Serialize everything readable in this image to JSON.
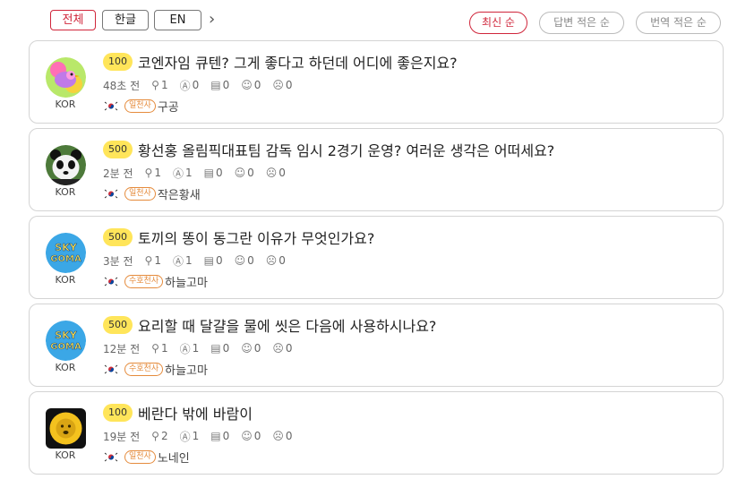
{
  "lang_tabs": [
    {
      "label": "전체",
      "active": true
    },
    {
      "label": "한글",
      "active": false
    },
    {
      "label": "EN",
      "active": false
    }
  ],
  "next_icon": "chevron-right-icon",
  "sort_options": [
    {
      "label": "최신 순",
      "active": true
    },
    {
      "label": "답변 적은 순",
      "active": false
    },
    {
      "label": "번역 적은 순",
      "active": false
    }
  ],
  "questions": [
    {
      "points": "100",
      "title": "코엔자임 큐텐? 그게 좋다고 하던데 어디에 좋은지요?",
      "time": "48초 전",
      "views": "1",
      "answers": "0",
      "comments": "0",
      "likes": "0",
      "dislikes": "0",
      "country": "KOR",
      "rank": "일천사",
      "user": "구공",
      "avatar": "bird-avatar"
    },
    {
      "points": "500",
      "title": "황선홍 올림픽대표팀 감독 임시 2경기 운영? 여러운 생각은 어떠세요?",
      "time": "2분 전",
      "views": "1",
      "answers": "1",
      "comments": "0",
      "likes": "0",
      "dislikes": "0",
      "country": "KOR",
      "rank": "일천사",
      "user": "작은황새",
      "avatar": "panda-avatar"
    },
    {
      "points": "500",
      "title": "토끼의 똥이 동그란 이유가 무엇인가요?",
      "time": "3분 전",
      "views": "1",
      "answers": "1",
      "comments": "0",
      "likes": "0",
      "dislikes": "0",
      "country": "KOR",
      "rank": "수호천사",
      "user": "하늘고마",
      "avatar": "skygoma-avatar"
    },
    {
      "points": "500",
      "title": "요리할 때 달걀을 물에 씻은 다음에 사용하시나요?",
      "time": "12분 전",
      "views": "1",
      "answers": "1",
      "comments": "0",
      "likes": "0",
      "dislikes": "0",
      "country": "KOR",
      "rank": "수호천사",
      "user": "하늘고마",
      "avatar": "skygoma-avatar"
    },
    {
      "points": "100",
      "title": "베란다 밖에 바람이",
      "time": "19분 전",
      "views": "2",
      "answers": "1",
      "comments": "0",
      "likes": "0",
      "dislikes": "0",
      "country": "KOR",
      "rank": "일천사",
      "user": "노네인",
      "avatar": "lion-avatar"
    }
  ],
  "skygoma_text": [
    "SKY",
    "GOMA"
  ],
  "colors": {
    "accent": "#d0263b",
    "points_bg": "#ffe55a",
    "rank": "#e58b3c"
  }
}
